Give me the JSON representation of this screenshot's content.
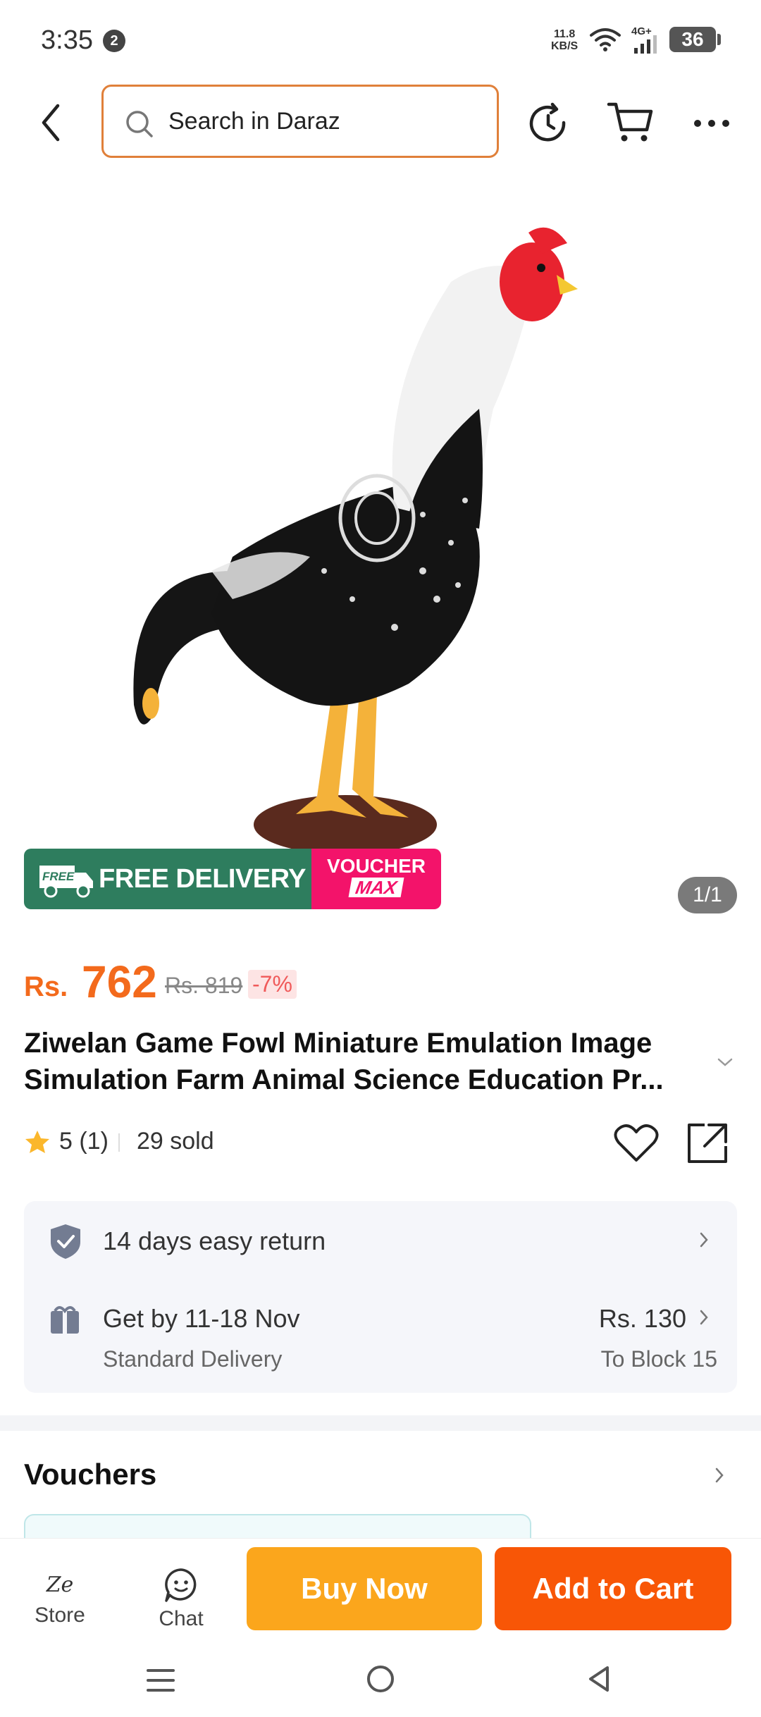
{
  "status_bar": {
    "time": "3:35",
    "notification_count": "2",
    "net_speed_value": "11.8",
    "net_speed_unit": "KB/S",
    "network_type": "4G+",
    "battery": "36"
  },
  "header": {
    "search_placeholder": "Search in Daraz"
  },
  "gallery": {
    "image_label": "product-photo-rooster-figurine",
    "page_indicator": "1/1",
    "badge_free_label": "FREE",
    "badge_free_delivery": "FREE DELIVERY",
    "badge_voucher": "VOUCHER",
    "badge_max": "MAX"
  },
  "product": {
    "currency": "Rs.",
    "price": "762",
    "original_price": "Rs. 819",
    "discount": "-7%",
    "title": "Ziwelan Game Fowl Miniature Emulation Image Simulation Farm Animal Science Education Pr...",
    "rating": "5 (1)",
    "sold": "29 sold"
  },
  "info_card": {
    "return_policy": "14 days easy return",
    "delivery_estimate": "Get by 11-18 Nov",
    "delivery_type": "Standard Delivery",
    "delivery_fee": "Rs. 130",
    "delivery_location": "To Block 15"
  },
  "vouchers": {
    "title": "Vouchers"
  },
  "bottom_bar": {
    "store_logo_text": "Ze",
    "store_label": "Store",
    "chat_label": "Chat",
    "buy_now": "Buy Now",
    "add_to_cart": "Add to Cart"
  },
  "colors": {
    "brand_orange": "#f85606",
    "buy_now": "#fba61c",
    "price": "#f36a1c",
    "free_delivery_bg": "#2e7d5e",
    "voucher_max_bg": "#f3136a",
    "search_border": "#e0803a"
  }
}
